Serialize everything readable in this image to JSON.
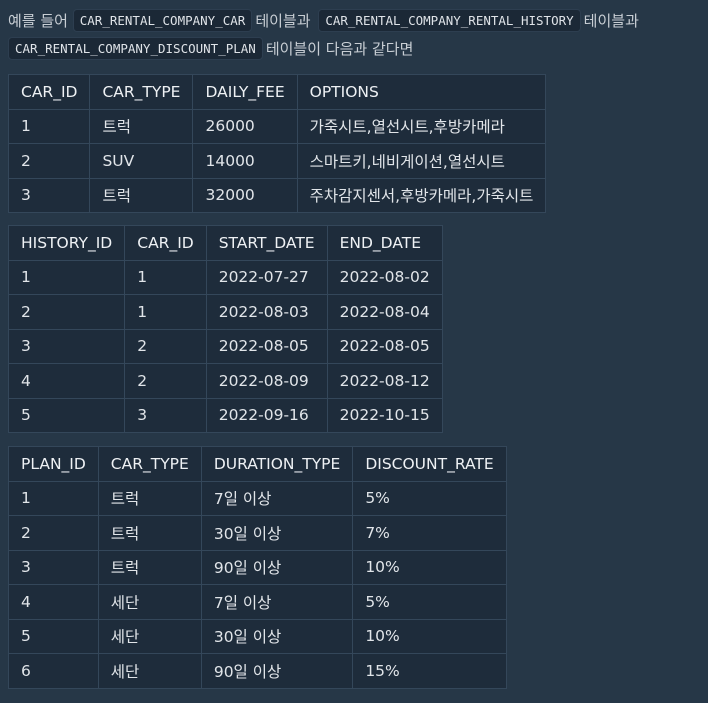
{
  "intro": {
    "line1_prefix": "예를 들어",
    "code1": "CAR_RENTAL_COMPANY_CAR",
    "mid1": "테이블과",
    "code2": "CAR_RENTAL_COMPANY_RENTAL_HISTORY",
    "mid2": "테이블과",
    "code3": "CAR_RENTAL_COMPANY_DISCOUNT_PLAN",
    "suffix": "테이블이 다음과 같다면"
  },
  "car_table": {
    "headers": [
      "CAR_ID",
      "CAR_TYPE",
      "DAILY_FEE",
      "OPTIONS"
    ],
    "rows": [
      [
        "1",
        "트럭",
        "26000",
        "가죽시트,열선시트,후방카메라"
      ],
      [
        "2",
        "SUV",
        "14000",
        "스마트키,네비게이션,열선시트"
      ],
      [
        "3",
        "트럭",
        "32000",
        "주차감지센서,후방카메라,가죽시트"
      ]
    ]
  },
  "history_table": {
    "headers": [
      "HISTORY_ID",
      "CAR_ID",
      "START_DATE",
      "END_DATE"
    ],
    "rows": [
      [
        "1",
        "1",
        "2022-07-27",
        "2022-08-02"
      ],
      [
        "2",
        "1",
        "2022-08-03",
        "2022-08-04"
      ],
      [
        "3",
        "2",
        "2022-08-05",
        "2022-08-05"
      ],
      [
        "4",
        "2",
        "2022-08-09",
        "2022-08-12"
      ],
      [
        "5",
        "3",
        "2022-09-16",
        "2022-10-15"
      ]
    ]
  },
  "plan_table": {
    "headers": [
      "PLAN_ID",
      "CAR_TYPE",
      "DURATION_TYPE",
      "DISCOUNT_RATE"
    ],
    "rows": [
      [
        "1",
        "트럭",
        "7일 이상",
        "5%"
      ],
      [
        "2",
        "트럭",
        "30일 이상",
        "7%"
      ],
      [
        "3",
        "트럭",
        "90일 이상",
        "10%"
      ],
      [
        "4",
        "세단",
        "7일 이상",
        "5%"
      ],
      [
        "5",
        "세단",
        "30일 이상",
        "10%"
      ],
      [
        "6",
        "세단",
        "90일 이상",
        "15%"
      ]
    ]
  }
}
